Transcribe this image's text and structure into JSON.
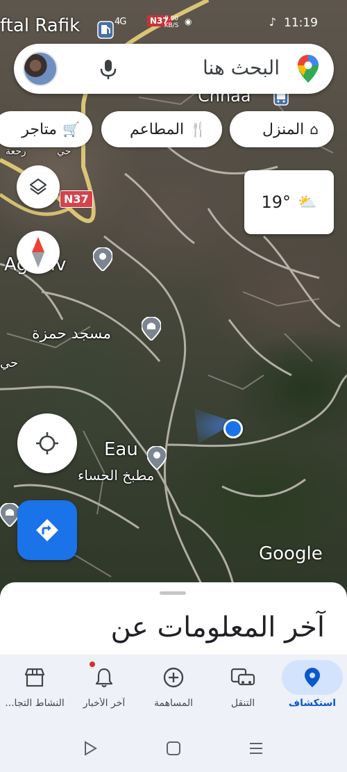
{
  "status_bar": {
    "time": "11:19",
    "network_badge": "N37",
    "net_speed": "0.00 KB/S",
    "signal": "4G"
  },
  "map": {
    "top_label": "ftal Rafik",
    "top_chinaa": "Chnaa",
    "route_badge_top": "N37",
    "route_badge_mid": "N37",
    "label_agadir": "Agadiv",
    "label_mosque": "مسجد حمزة",
    "label_eau": "Eau",
    "label_kitchen": "مطبخ الحساء",
    "label_left_1": "حي",
    "label_left_2": "حي",
    "label_rajja": "رحعة",
    "google_logo": "Google"
  },
  "search": {
    "placeholder": "البحث هنا"
  },
  "chips": {
    "home": "المنزل",
    "restaurants": "المطاعم",
    "stores": "متاجر"
  },
  "weather": {
    "temperature": "19°"
  },
  "sheet": {
    "heading": "آخر المعلومات عن"
  },
  "bottom_nav": {
    "items": [
      {
        "label": "استكشاف",
        "active": true
      },
      {
        "label": "التنقل",
        "active": false
      },
      {
        "label": "المساهمة",
        "active": false
      },
      {
        "label": "آخر الأخبار",
        "active": false
      },
      {
        "label": "النشاط التجا...",
        "active": false
      }
    ]
  },
  "colors": {
    "accent": "#1a73e8",
    "active_nav_bg": "#d3e3fd",
    "route_badge": "#d5434b",
    "notification_dot": "#d93025"
  }
}
